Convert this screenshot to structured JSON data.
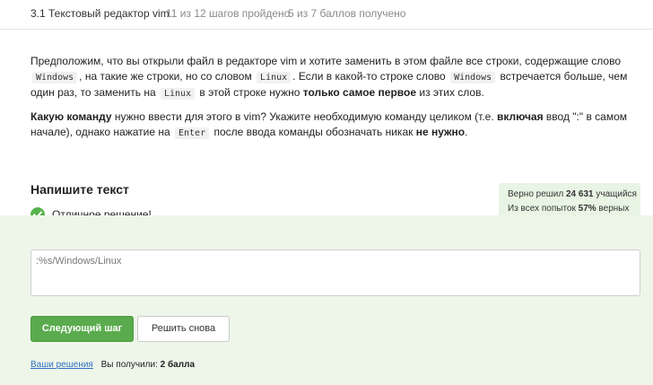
{
  "header": {
    "title": "3.1 Текстовый редактор vim",
    "steps": "11 из 12 шагов пройдено",
    "score": "5 из 7 баллов  получено"
  },
  "task": {
    "p1": [
      "Предположим, что вы открыли файл в редакторе vim и хотите заменить в этом файле все строки, содержащие слово ",
      "Windows",
      ", на такие же строки, но со словом ",
      "Linux",
      ". Если в какой-то строке слово ",
      "Windows",
      " встречается больше, чем один раз, то заменить на ",
      "Linux",
      " в этой строке нужно ",
      "только самое первое",
      " из этих слов."
    ],
    "p2": [
      "Какую команду",
      " нужно ввести для этого в vim? Укажите необходимую команду целиком (т.е. ",
      "включая",
      " ввод \":\" в самом начале), однако нажатие на ",
      "Enter",
      " после ввода команды обозначать никак ",
      "не нужно",
      "."
    ]
  },
  "write_title": "Напишите текст",
  "status": {
    "text": "Отличное решение!",
    "icon": "check-circle-icon",
    "color": "#59b34d"
  },
  "stats": {
    "line1_prefix": "Верно решил ",
    "line1_value": "24 631",
    "line1_suffix": " учащийся",
    "line2_prefix": "Из всех попыток ",
    "line2_value": "57%",
    "line2_suffix": " верных"
  },
  "answer": {
    "value": ":%s/Windows/Linux"
  },
  "buttons": {
    "next": "Следующий шаг",
    "retry": "Решить снова"
  },
  "footer": {
    "link": "Ваши решения",
    "prefix": "Вы получили: ",
    "points": "2 балла"
  },
  "colors": {
    "accent_green": "#5aab4d",
    "answer_bg": "#eef6ea",
    "stats_bg": "#e8f4e4",
    "link": "#2f6fbf"
  }
}
